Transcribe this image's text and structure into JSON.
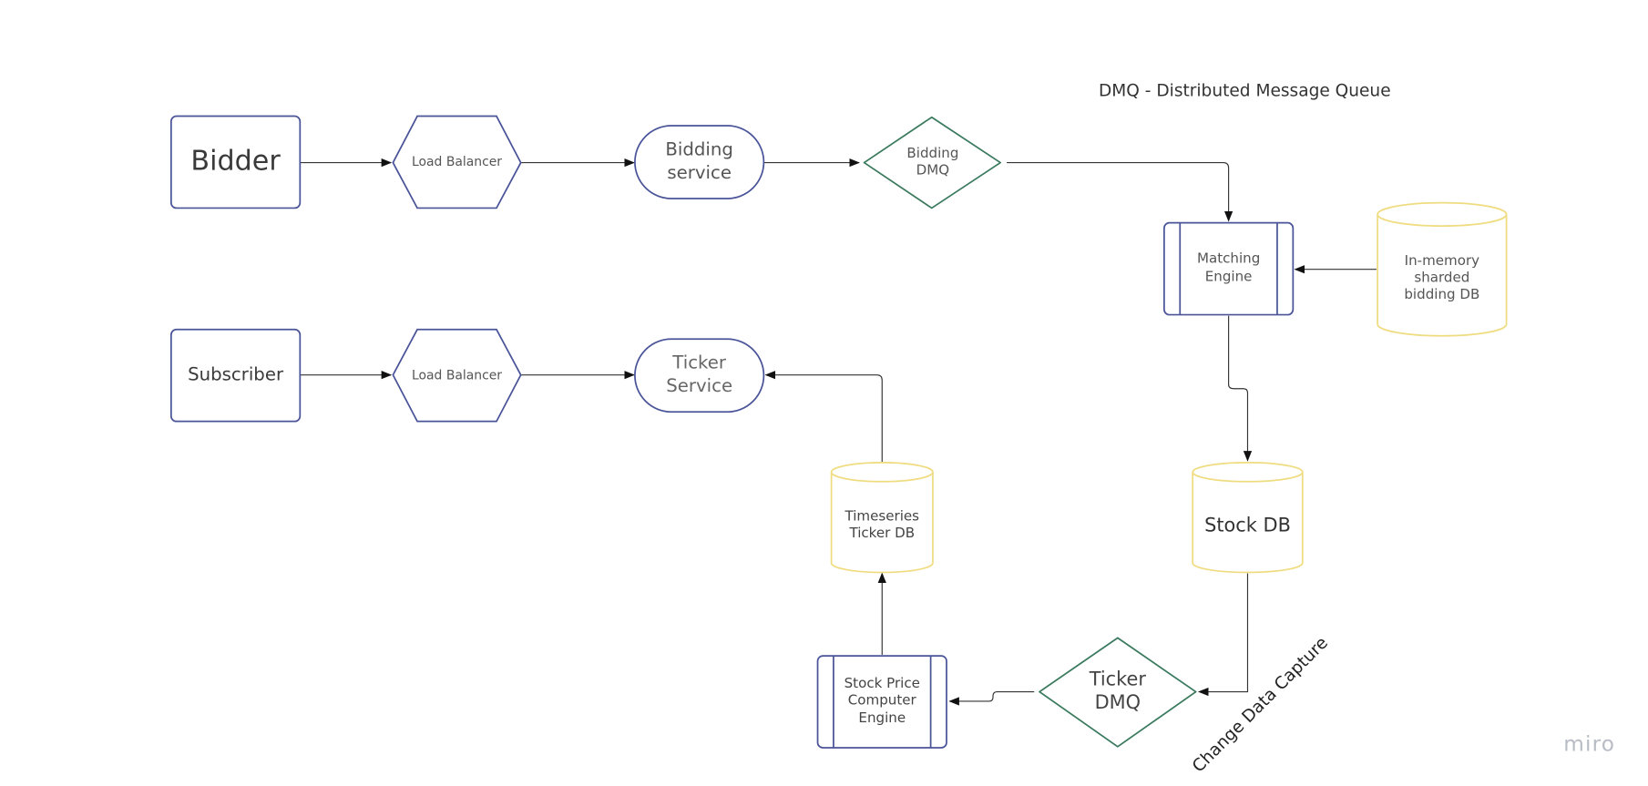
{
  "diagram": {
    "legend_title": "DMQ - Distributed Message Queue",
    "edge_label": "Change Data Capture",
    "watermark": "miro",
    "colors": {
      "client_stroke": "#4a5499",
      "queue_stroke": "#3a7a5e",
      "db_stroke": "#f0dc80",
      "connector": "#333333"
    },
    "nodes": {
      "bidder": {
        "label": "Bidder",
        "shape": "rounded-rectangle"
      },
      "lb_top": {
        "label": "Load Balancer",
        "shape": "hexagon"
      },
      "bidding_service": {
        "label": "Bidding service",
        "shape": "stadium"
      },
      "bidding_dmq": {
        "label": "Bidding DMQ",
        "shape": "diamond"
      },
      "matching_engine": {
        "label": "Matching Engine",
        "shape": "process"
      },
      "inmem_db": {
        "label": "In-memory sharded bidding DB",
        "shape": "cylinder"
      },
      "subscriber": {
        "label": "Subscriber",
        "shape": "rounded-rectangle"
      },
      "lb_bottom": {
        "label": "Load Balancer",
        "shape": "hexagon"
      },
      "ticker_service": {
        "label": "Ticker Service",
        "shape": "stadium"
      },
      "timeseries_db": {
        "label": "Timeseries Ticker DB",
        "shape": "cylinder"
      },
      "stock_db": {
        "label": "Stock DB",
        "shape": "cylinder"
      },
      "ticker_dmq": {
        "label": "Ticker DMQ",
        "shape": "diamond"
      },
      "price_engine": {
        "label": "Stock Price Computer Engine",
        "shape": "process"
      }
    },
    "edges": [
      {
        "from": "Bidder",
        "to": "Load Balancer"
      },
      {
        "from": "Load Balancer",
        "to": "Bidding service"
      },
      {
        "from": "Bidding service",
        "to": "Bidding DMQ"
      },
      {
        "from": "Bidding DMQ",
        "to": "Matching Engine"
      },
      {
        "from": "In-memory sharded bidding DB",
        "to": "Matching Engine"
      },
      {
        "from": "Matching Engine",
        "to": "Stock DB"
      },
      {
        "from": "Stock DB",
        "to": "Ticker DMQ",
        "label": "Change Data Capture"
      },
      {
        "from": "Ticker DMQ",
        "to": "Stock Price Computer Engine"
      },
      {
        "from": "Stock Price Computer Engine",
        "to": "Timeseries Ticker DB"
      },
      {
        "from": "Timeseries Ticker DB",
        "to": "Ticker Service"
      },
      {
        "from": "Subscriber",
        "to": "Load Balancer"
      },
      {
        "from": "Load Balancer",
        "to": "Ticker Service"
      }
    ]
  }
}
